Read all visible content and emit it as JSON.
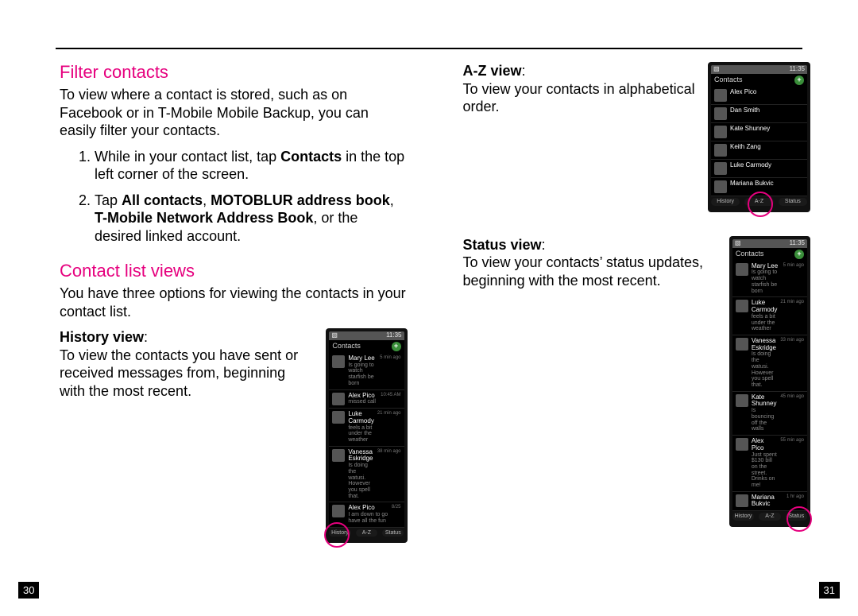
{
  "page_left": "30",
  "page_right": "31",
  "filter": {
    "heading": "Filter contacts",
    "intro": "To view where a contact is stored, such as on Facebook or in T-Mobile Mobile Backup, you can easily filter your contacts.",
    "step1_pre": "While in your contact list, tap ",
    "step1_bold": "Contacts",
    "step1_post": " in the top left corner of the screen.",
    "step2_pre": "Tap ",
    "step2_b1": "All contacts",
    "step2_mid1": ", ",
    "step2_b2": "MOTOBLUR address book",
    "step2_mid2": ", ",
    "step2_b3": "T-Mobile Network Address Book",
    "step2_post": ", or the desired linked account."
  },
  "views": {
    "heading": "Contact list views",
    "intro": "You have three options for viewing the contacts in your contact list.",
    "history": {
      "label": "History view",
      "colon": ":",
      "desc": "To view the contacts you have sent or received messages from, beginning with the most recent."
    },
    "az": {
      "label": "A-Z view",
      "colon": ":",
      "desc": "To view your contacts in alphabetical order."
    },
    "status": {
      "label": "Status view",
      "colon": ":",
      "desc": "To view your contacts’ status updates, beginning with the most recent."
    }
  },
  "phone_common": {
    "time": "11:35",
    "header": "Contacts",
    "tabs": {
      "history": "History",
      "az": "A-Z",
      "status": "Status"
    }
  },
  "phone_history": {
    "rows": [
      {
        "name": "Mary Lee",
        "detail": "Is going to watch starfish be born",
        "time": "5 min ago"
      },
      {
        "name": "Alex Pico",
        "detail": "missed call",
        "time": "10:45 AM"
      },
      {
        "name": "Luke Carmody",
        "detail": "feels a bit under the weather",
        "time": "21 min ago"
      },
      {
        "name": "Vanessa Eskridge",
        "detail": "Is doing the watusi. However you spell that.",
        "time": "38 min ago"
      },
      {
        "name": "Alex Pico",
        "detail": "I am down to go have all the fun",
        "time": "8/25"
      }
    ]
  },
  "phone_az": {
    "rows": [
      {
        "name": "Alex Pico"
      },
      {
        "name": "Dan Smith"
      },
      {
        "name": "Kate Shunney"
      },
      {
        "name": "Keith Zang"
      },
      {
        "name": "Luke Carmody"
      },
      {
        "name": "Mariana Bukvic"
      }
    ]
  },
  "phone_status": {
    "rows": [
      {
        "name": "Mary Lee",
        "detail": "Is going to watch starfish be born",
        "time": "5 min ago"
      },
      {
        "name": "Luke Carmody",
        "detail": "feels a bit under the weather",
        "time": "21 min ago"
      },
      {
        "name": "Vanessa Eskridge",
        "detail": "Is doing the watusi. However you spell that.",
        "time": "33 min ago"
      },
      {
        "name": "Kate Shunney",
        "detail": "Is bouncing off the walls",
        "time": "45 min ago"
      },
      {
        "name": "Alex Pico",
        "detail": "Just spent $130 bill on the street. Drinks on me!",
        "time": "55 min ago"
      },
      {
        "name": "Mariana Bukvic",
        "detail": "",
        "time": "1 hr ago"
      }
    ]
  }
}
